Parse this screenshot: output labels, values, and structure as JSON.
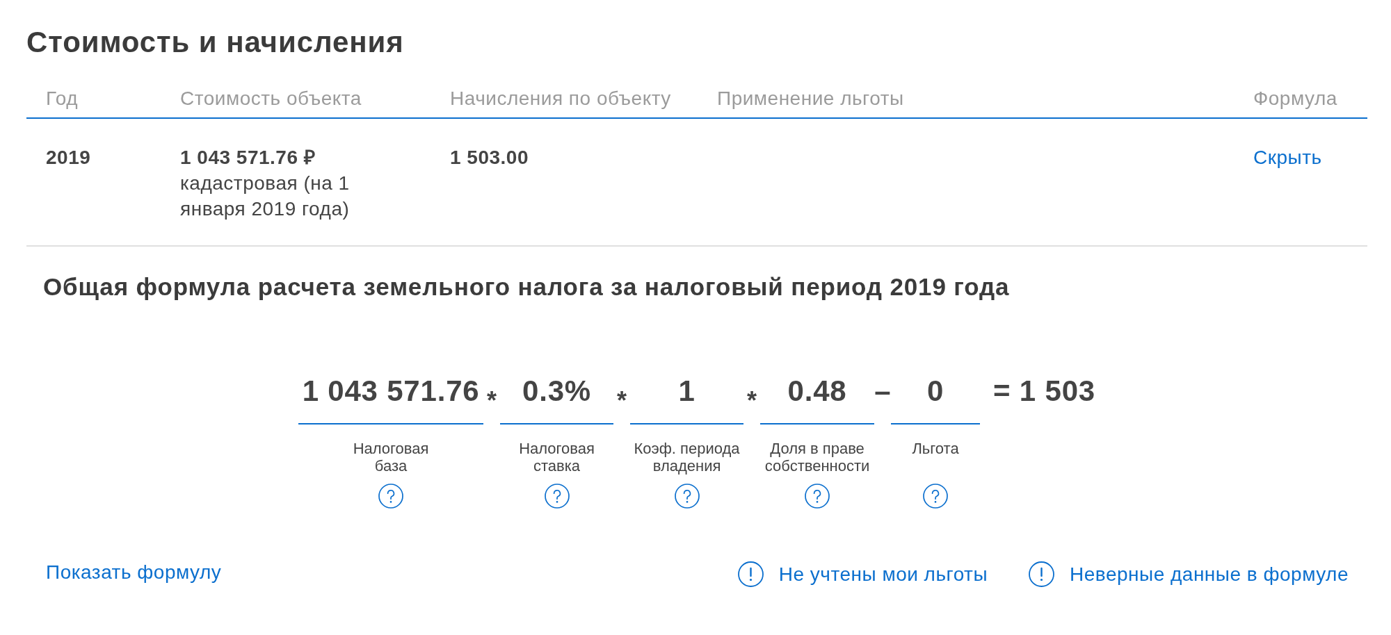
{
  "title": "Стоимость и начисления",
  "table": {
    "columns": [
      "Год",
      "Стоимость объекта",
      "Начисления по объекту",
      "Применение льготы",
      "Формула"
    ],
    "rows": [
      {
        "year": "2019",
        "value": "1 043 571.76 ₽",
        "value_note": "кадастровая (на 1 января 2019 года)",
        "charges": "1 503.00",
        "formula_link": "Скрыть"
      }
    ]
  },
  "formula": {
    "title": "Общая формула расчета земельного налога за налоговый период 2019 года",
    "terms": [
      {
        "value": "1 043 571.76",
        "label": "Налоговая база",
        "operator": {
          "kind": "multiply",
          "symbol": "*"
        }
      },
      {
        "value": "0.3%",
        "label": "Налоговая ставка",
        "operator": {
          "kind": "multiply",
          "symbol": "*"
        }
      },
      {
        "value": "1",
        "label": "Коэф. периода владения",
        "operator": {
          "kind": "multiply",
          "symbol": "*"
        }
      },
      {
        "value": "0.48",
        "label": "Доля в праве собственности",
        "operator": {
          "kind": "minus",
          "symbol": "–"
        }
      },
      {
        "value": "0",
        "label": "Льгота"
      }
    ],
    "result": "= 1 503"
  },
  "links": {
    "show_formula": "Показать формулу",
    "actions": [
      {
        "label": "Не учтены мои льготы"
      },
      {
        "label": "Неверные данные в формуле"
      }
    ]
  }
}
